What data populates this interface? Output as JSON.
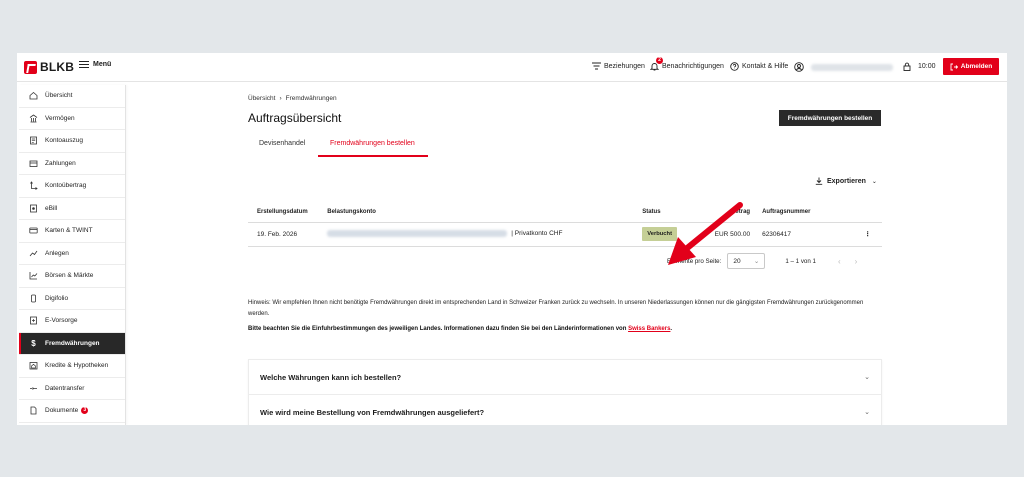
{
  "header": {
    "brand": "BLKB",
    "menu_label": "Menü",
    "relations_label": "Beziehungen",
    "notifications_label": "Benachrichtigungen",
    "notifications_count": "2",
    "contact_label": "Kontakt & Hilfe",
    "session_time": "10:00",
    "logout_label": "Abmelden"
  },
  "sidebar": {
    "items": [
      {
        "label": "Übersicht",
        "icon": "home-icon"
      },
      {
        "label": "Vermögen",
        "icon": "bank-icon"
      },
      {
        "label": "Kontoauszug",
        "icon": "statement-icon"
      },
      {
        "label": "Zahlungen",
        "icon": "payment-icon"
      },
      {
        "label": "Kontoübertrag",
        "icon": "transfer-icon"
      },
      {
        "label": "eBill",
        "icon": "ebill-icon"
      },
      {
        "label": "Karten & TWINT",
        "icon": "card-icon"
      },
      {
        "label": "Anlegen",
        "icon": "invest-icon"
      },
      {
        "label": "Börsen & Märkte",
        "icon": "chart-icon"
      },
      {
        "label": "Digifolio",
        "icon": "digifolio-icon"
      },
      {
        "label": "E-Vorsorge",
        "icon": "pension-icon"
      },
      {
        "label": "Fremdwährungen",
        "icon": "dollar-icon"
      },
      {
        "label": "Kredite & Hypotheken",
        "icon": "house-loan-icon"
      },
      {
        "label": "Datentransfer",
        "icon": "data-transfer-icon"
      },
      {
        "label": "Dokumente",
        "icon": "document-icon",
        "badge": "3"
      }
    ],
    "active_index": 11
  },
  "main": {
    "breadcrumb": [
      "Übersicht",
      "Fremdwährungen"
    ],
    "title": "Auftragsübersicht",
    "order_button": "Fremdwährungen bestellen",
    "tabs": [
      "Devisenhandel",
      "Fremdwährungen bestellen"
    ],
    "active_tab": 1,
    "export_label": "Exportieren",
    "table": {
      "headers": [
        "Erstellungsdatum",
        "Belastungskonto",
        "Status",
        "Betrag",
        "Auftragsnummer"
      ],
      "rows": [
        {
          "date": "19. Feb. 2026",
          "account_suffix": "| Privatkonto CHF",
          "status": "Verbucht",
          "amount": "EUR 500.00",
          "order_no": "62306417"
        }
      ]
    },
    "pager": {
      "per_page_label": "Elemente pro Seite:",
      "per_page_value": "20",
      "range": "1 – 1 von 1"
    },
    "hint": "Hinweis: Wir empfehlen Ihnen nicht benötigte Fremdwährungen direkt im entsprechenden Land in Schweizer Franken zurück zu wechseln. In unseren Niederlassungen können nur die gängigsten Fremdwährungen zurückgenommen werden.",
    "hint2_text": "Bitte beachten Sie die Einfuhrbestimmungen des jeweiligen Landes. Informationen dazu finden Sie bei den Länderinformationen von ",
    "hint2_link": "Swiss Bankers",
    "hint2_end": ".",
    "faq": [
      "Welche Währungen kann ich bestellen?",
      "Wie wird meine Bestellung von Fremdwährungen ausgeliefert?"
    ]
  },
  "colors": {
    "brand_red": "#e2001a",
    "dark": "#282828",
    "status_green": "#c5cf96"
  }
}
